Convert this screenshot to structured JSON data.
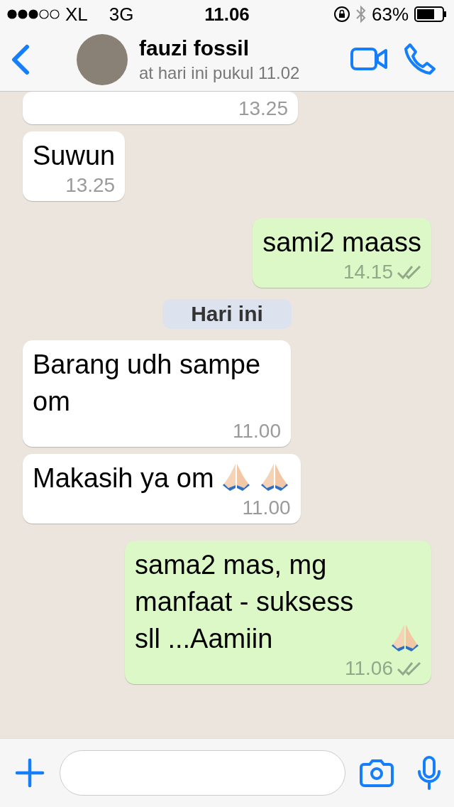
{
  "status_bar": {
    "carrier": "XL",
    "network": "3G",
    "time": "11.06",
    "battery": "63%"
  },
  "header": {
    "name": "fauzi fossil",
    "subtitle": "at hari ini pukul 11.02"
  },
  "messages": [
    {
      "kind": "in",
      "time": "13.25"
    },
    {
      "kind": "in",
      "text": "Suwun",
      "time": "13.25"
    },
    {
      "kind": "out",
      "text": "sami2 maass",
      "time": "14.15",
      "read": false
    },
    {
      "kind": "date",
      "text": "Hari ini"
    },
    {
      "kind": "in",
      "text": "Barang udh sampe om",
      "time": "11.00"
    },
    {
      "kind": "in",
      "text": "Makasih ya om",
      "emoji": [
        {
          "kind": "pray"
        },
        {
          "kind": "pray"
        }
      ],
      "time": "11.00"
    },
    {
      "kind": "out",
      "text": "sama2 mas, mg manfaat - suksess sll ...Aamiin",
      "emoji": [
        {
          "kind": "pray"
        }
      ],
      "time": "11.06",
      "read": false
    }
  ]
}
